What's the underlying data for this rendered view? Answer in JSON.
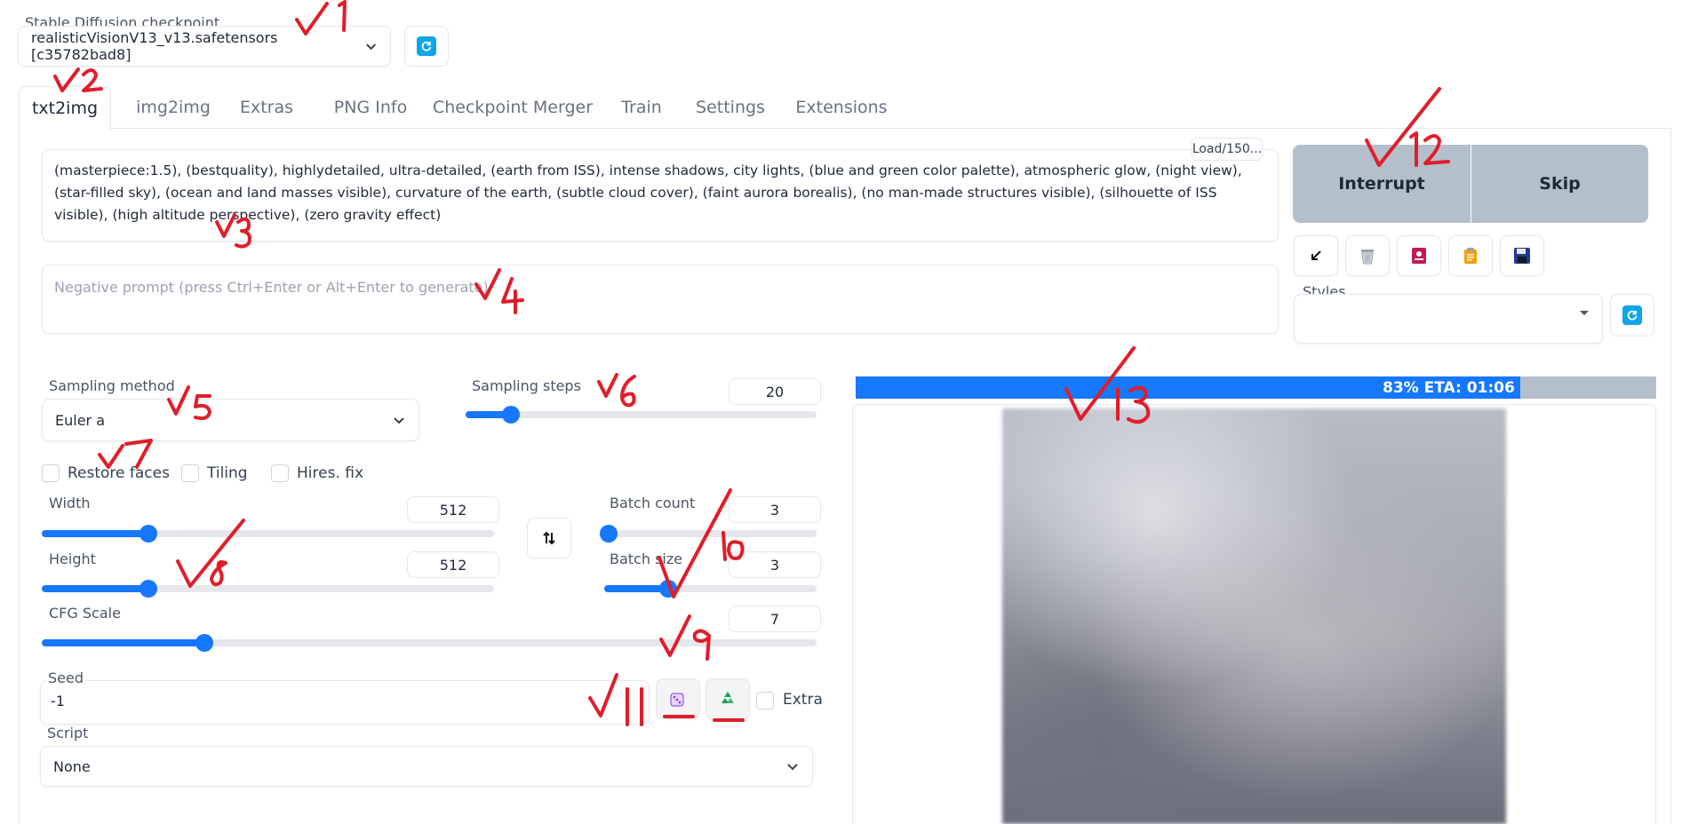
{
  "checkpoint": {
    "label": "Stable Diffusion checkpoint",
    "value": "realisticVisionV13_v13.safetensors [c35782bad8]"
  },
  "tabs": [
    {
      "label": "txt2img",
      "active": true
    },
    {
      "label": "img2img"
    },
    {
      "label": "Extras"
    },
    {
      "label": "PNG Info"
    },
    {
      "label": "Checkpoint Merger"
    },
    {
      "label": "Train"
    },
    {
      "label": "Settings"
    },
    {
      "label": "Extensions"
    }
  ],
  "prompt": {
    "text": "(masterpiece:1.5), (bestquality), highlydetailed, ultra-detailed, (earth from ISS), intense shadows, city lights, (blue and green color palette), atmospheric glow, (night view), (star-filled sky), (ocean and land masses visible), curvature of the earth, (subtle cloud cover), (faint aurora borealis), (no man-made structures visible), (silhouette of ISS visible), (high altitude perspective), (zero gravity effect)",
    "token_badge": "Load/150..."
  },
  "negative_prompt": {
    "placeholder": "Negative prompt (press Ctrl+Enter or Alt+Enter to generate)"
  },
  "actions": {
    "interrupt": "Interrupt",
    "skip": "Skip"
  },
  "styles": {
    "label": "Styles",
    "value": ""
  },
  "sampling_method": {
    "label": "Sampling method",
    "value": "Euler a"
  },
  "sampling_steps": {
    "label": "Sampling steps",
    "value": "20",
    "fraction": 0.13
  },
  "checkboxes": {
    "restore_faces": "Restore faces",
    "tiling": "Tiling",
    "hires_fix": "Hires. fix"
  },
  "width": {
    "label": "Width",
    "value": "512",
    "fraction": 0.235
  },
  "height": {
    "label": "Height",
    "value": "512",
    "fraction": 0.235
  },
  "batch_count": {
    "label": "Batch count",
    "value": "3",
    "fraction": 0.02
  },
  "batch_size": {
    "label": "Batch size",
    "value": "3",
    "fraction": 0.3
  },
  "cfg_scale": {
    "label": "CFG Scale",
    "value": "7",
    "fraction": 0.21
  },
  "seed": {
    "label": "Seed",
    "value": "-1",
    "extra_label": "Extra"
  },
  "script": {
    "label": "Script",
    "value": "None"
  },
  "progress": {
    "text": "83% ETA: 01:06",
    "fraction": 0.83
  },
  "colors": {
    "accent": "#1677ff",
    "button_bg": "#b3bfcb",
    "annotation": "#e11d2a"
  },
  "annotations": [
    "1",
    "2",
    "3",
    "4",
    "5",
    "6",
    "7",
    "8",
    "9",
    "10",
    "11",
    "12",
    "13"
  ]
}
